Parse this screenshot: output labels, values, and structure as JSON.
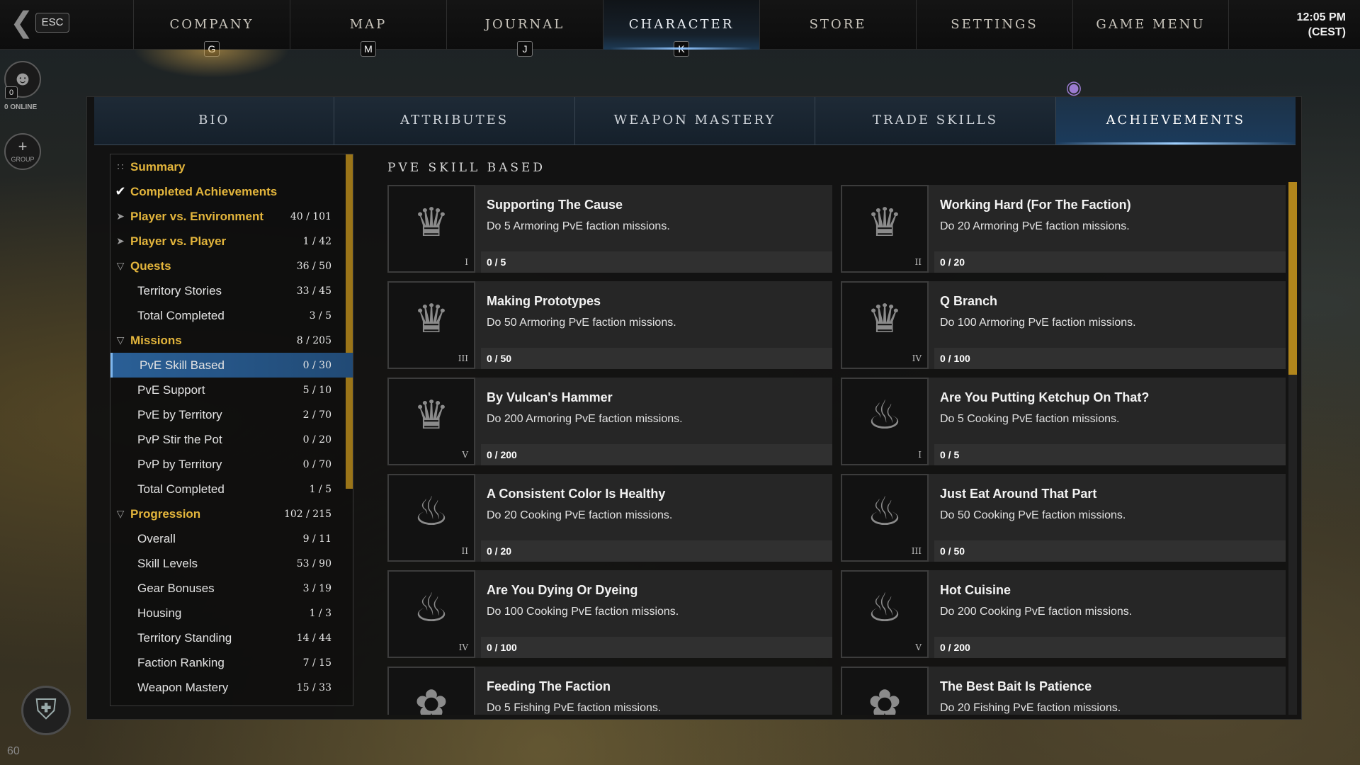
{
  "topbar": {
    "esc_label": "ESC",
    "clock_time": "12:05 PM",
    "clock_zone": "(CEST)",
    "nav": [
      {
        "label": "COMPANY",
        "key": "G"
      },
      {
        "label": "MAP",
        "key": "M"
      },
      {
        "label": "JOURNAL",
        "key": "J"
      },
      {
        "label": "CHARACTER",
        "key": "K"
      },
      {
        "label": "STORE",
        "key": ""
      },
      {
        "label": "SETTINGS",
        "key": ""
      },
      {
        "label": "GAME MENU",
        "key": ""
      }
    ],
    "active_nav": "CHARACTER"
  },
  "social": {
    "online_count": "0",
    "online_label": "0 ONLINE",
    "group_label": "GROUP",
    "level": "60"
  },
  "subtabs": [
    "BIO",
    "ATTRIBUTES",
    "WEAPON MASTERY",
    "TRADE SKILLS",
    "ACHIEVEMENTS"
  ],
  "active_subtab": "ACHIEVEMENTS",
  "sidebar": [
    {
      "label": "Summary",
      "count": "",
      "type": "cat",
      "icon": "grid-icon"
    },
    {
      "label": "Completed Achievements",
      "count": "",
      "type": "cat",
      "icon": "check-icon"
    },
    {
      "label": "Player vs. Environment",
      "count": "40 / 101",
      "type": "cat",
      "icon": "expand-arrow-icon"
    },
    {
      "label": "Player vs. Player",
      "count": "1 / 42",
      "type": "cat",
      "icon": "expand-arrow-icon"
    },
    {
      "label": "Quests",
      "count": "36 / 50",
      "type": "cat",
      "icon": "collapse-arrow-icon"
    },
    {
      "label": "Territory Stories",
      "count": "33 / 45",
      "type": "sub"
    },
    {
      "label": "Total Completed",
      "count": "3 / 5",
      "type": "sub"
    },
    {
      "label": "Missions",
      "count": "8 / 205",
      "type": "cat",
      "icon": "collapse-arrow-icon"
    },
    {
      "label": "PvE Skill Based",
      "count": "0 / 30",
      "type": "sub",
      "selected": true
    },
    {
      "label": "PvE Support",
      "count": "5 / 10",
      "type": "sub"
    },
    {
      "label": "PvE by Territory",
      "count": "2 / 70",
      "type": "sub"
    },
    {
      "label": "PvP Stir the Pot",
      "count": "0 / 20",
      "type": "sub"
    },
    {
      "label": "PvP by Territory",
      "count": "0 / 70",
      "type": "sub"
    },
    {
      "label": "Total Completed",
      "count": "1 / 5",
      "type": "sub"
    },
    {
      "label": "Progression",
      "count": "102 / 215",
      "type": "cat",
      "icon": "collapse-arrow-icon"
    },
    {
      "label": "Overall",
      "count": "9 / 11",
      "type": "sub"
    },
    {
      "label": "Skill Levels",
      "count": "53 / 90",
      "type": "sub"
    },
    {
      "label": "Gear Bonuses",
      "count": "3 / 19",
      "type": "sub"
    },
    {
      "label": "Housing",
      "count": "1 / 3",
      "type": "sub"
    },
    {
      "label": "Territory Standing",
      "count": "14 / 44",
      "type": "sub"
    },
    {
      "label": "Faction Ranking",
      "count": "7 / 15",
      "type": "sub"
    },
    {
      "label": "Weapon Mastery",
      "count": "15 / 33",
      "type": "sub"
    }
  ],
  "content": {
    "title": "PVE SKILL BASED",
    "achievements": [
      {
        "name": "Supporting The Cause",
        "desc": "Do 5 Armoring PvE faction missions.",
        "progress": "0 / 5",
        "tier": "I",
        "icon": "armor-icon"
      },
      {
        "name": "Working Hard (For The Faction)",
        "desc": "Do 20 Armoring PvE faction missions.",
        "progress": "0 / 20",
        "tier": "II",
        "icon": "armor-icon"
      },
      {
        "name": "Making Prototypes",
        "desc": "Do 50 Armoring PvE faction missions.",
        "progress": "0 / 50",
        "tier": "III",
        "icon": "armor-icon"
      },
      {
        "name": "Q Branch",
        "desc": "Do 100 Armoring PvE faction missions.",
        "progress": "0 / 100",
        "tier": "IV",
        "icon": "armor-icon"
      },
      {
        "name": "By Vulcan's Hammer",
        "desc": "Do 200 Armoring PvE faction missions.",
        "progress": "0 / 200",
        "tier": "V",
        "icon": "armor-icon"
      },
      {
        "name": "Are You Putting Ketchup On That?",
        "desc": "Do 5 Cooking PvE faction missions.",
        "progress": "0 / 5",
        "tier": "I",
        "icon": "cooking-icon"
      },
      {
        "name": "A Consistent Color Is Healthy",
        "desc": "Do 20 Cooking PvE faction missions.",
        "progress": "0 / 20",
        "tier": "II",
        "icon": "cooking-icon"
      },
      {
        "name": "Just Eat Around That Part",
        "desc": "Do 50 Cooking PvE faction missions.",
        "progress": "0 / 50",
        "tier": "III",
        "icon": "cooking-icon"
      },
      {
        "name": "Are You Dying Or Dyeing",
        "desc": "Do 100 Cooking PvE faction missions.",
        "progress": "0 / 100",
        "tier": "IV",
        "icon": "cooking-icon"
      },
      {
        "name": "Hot Cuisine",
        "desc": "Do 200 Cooking PvE faction missions.",
        "progress": "0 / 200",
        "tier": "V",
        "icon": "cooking-icon"
      },
      {
        "name": "Feeding The Faction",
        "desc": "Do 5 Fishing PvE faction missions.",
        "progress": "",
        "tier": "",
        "icon": "fishing-icon"
      },
      {
        "name": "The Best Bait Is Patience",
        "desc": "Do 20 Fishing PvE faction missions.",
        "progress": "",
        "tier": "",
        "icon": "fishing-icon"
      }
    ]
  }
}
